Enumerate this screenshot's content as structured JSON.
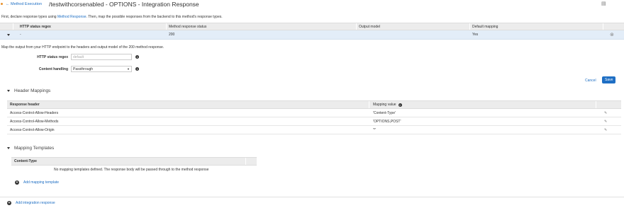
{
  "header": {
    "back_label": "← Method Execution",
    "title": "/testwithcorsenabled - OPTIONS - Integration Response"
  },
  "intro": {
    "prefix": "First, declare response types using ",
    "link": "Method Response",
    "suffix": ". Then, map the possible responses from the backend to this method's response types."
  },
  "responses_table": {
    "columns": [
      "HTTP status regex",
      "Method response status",
      "Output model",
      "Default mapping"
    ],
    "row": {
      "regex": "-",
      "status": "200",
      "output_model": "",
      "default_mapping": "Yes"
    }
  },
  "panel": {
    "description": "Map the output from your HTTP endpoint to the headers and output model of the 200 method response.",
    "regex_label": "HTTP status regex",
    "regex_placeholder": "default",
    "content_handling_label": "Content handling",
    "content_handling_value": "Passthrough",
    "cancel_label": "Cancel",
    "save_label": "Save"
  },
  "header_mappings": {
    "title": "Header Mappings",
    "col_header": "Response header",
    "col_value": "Mapping value",
    "rows": [
      {
        "header": "Access-Control-Allow-Headers",
        "value": "'Content-Type'"
      },
      {
        "header": "Access-Control-Allow-Methods",
        "value": "'OPTIONS,POST'"
      },
      {
        "header": "Access-Control-Allow-Origin",
        "value": "'*'"
      }
    ]
  },
  "mapping_templates": {
    "title": "Mapping Templates",
    "col_content_type": "Content-Type",
    "empty_message": "No mapping templates defined. The response body will be passed through to the method response",
    "add_label": "Add mapping template"
  },
  "footer": {
    "add_integration_label": "Add integration response"
  },
  "icons": {
    "info": "info-icon",
    "pencil": "pencil-icon",
    "close": "close-circle-icon",
    "plus": "plus-circle-icon",
    "settings": "page-settings-icon"
  },
  "colors": {
    "link": "#1f6fc4",
    "selected_row": "#e3edf8",
    "header_bg": "#ececec",
    "save_button": "#1f6fc4"
  }
}
